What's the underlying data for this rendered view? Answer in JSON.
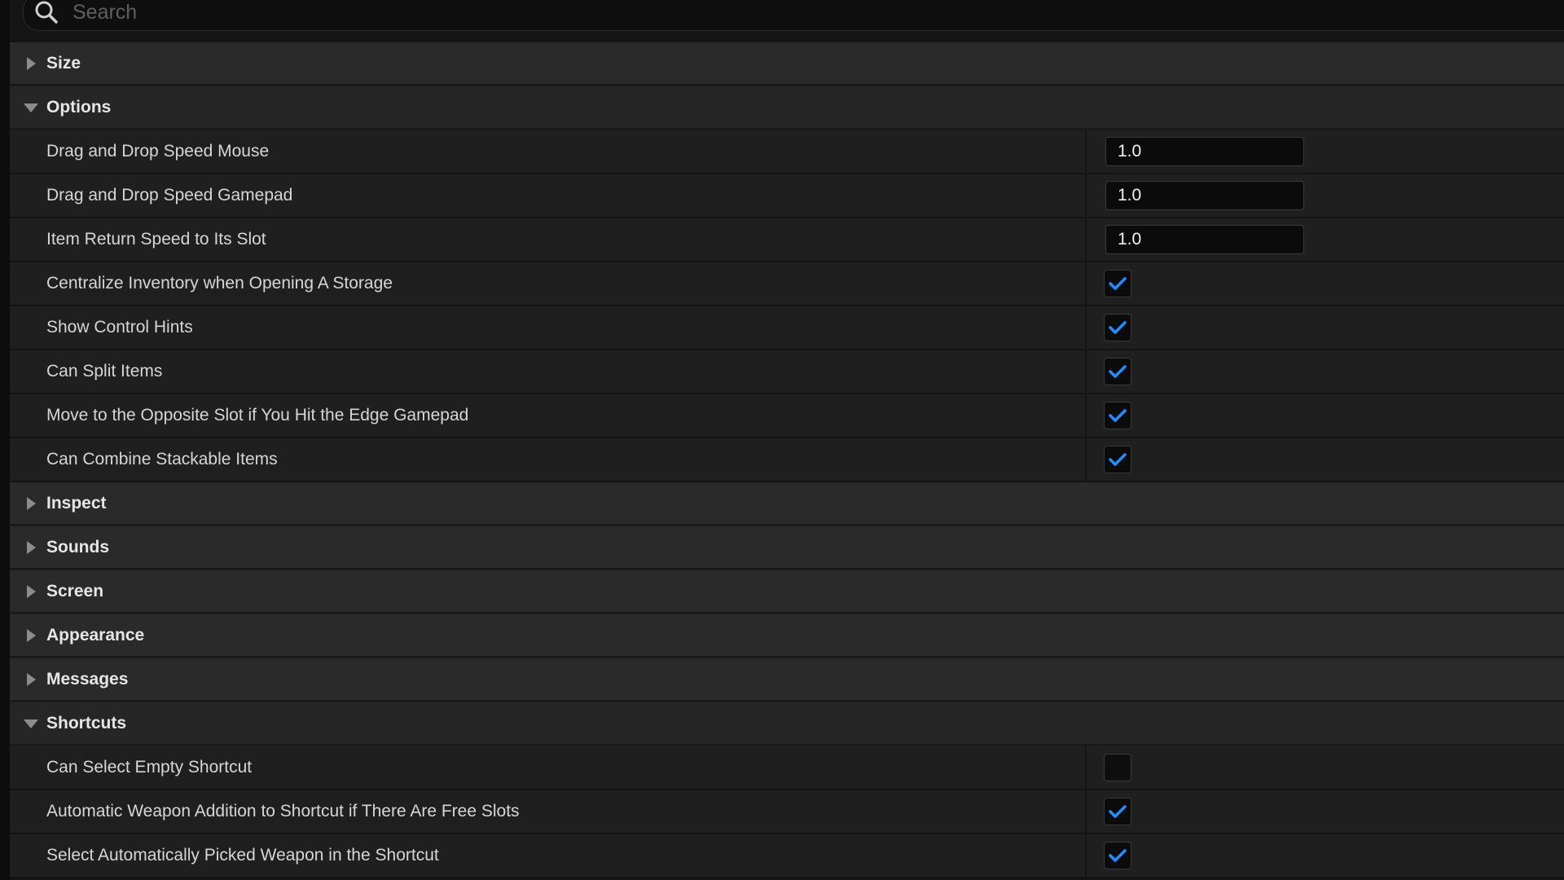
{
  "search": {
    "placeholder": "Search"
  },
  "colors": {
    "accent": "#1f8fff",
    "background": "#151515",
    "category_bg": "#2a2a2a",
    "property_bg": "#1f1f1f"
  },
  "categories": {
    "size": {
      "label": "Size",
      "expanded": false
    },
    "options": {
      "label": "Options",
      "expanded": true,
      "props": [
        {
          "label": "Drag and Drop Speed Mouse",
          "type": "number",
          "value": "1.0"
        },
        {
          "label": "Drag and Drop Speed Gamepad",
          "type": "number",
          "value": "1.0"
        },
        {
          "label": "Item Return Speed to Its Slot",
          "type": "number",
          "value": "1.0"
        },
        {
          "label": "Centralize Inventory when Opening A Storage",
          "type": "checkbox",
          "checked": true
        },
        {
          "label": "Show Control Hints",
          "type": "checkbox",
          "checked": true
        },
        {
          "label": "Can Split Items",
          "type": "checkbox",
          "checked": true
        },
        {
          "label": "Move to the Opposite Slot if You Hit the Edge Gamepad",
          "type": "checkbox",
          "checked": true
        },
        {
          "label": "Can Combine Stackable Items",
          "type": "checkbox",
          "checked": true
        }
      ]
    },
    "inspect": {
      "label": "Inspect",
      "expanded": false
    },
    "sounds": {
      "label": "Sounds",
      "expanded": false
    },
    "screen": {
      "label": "Screen",
      "expanded": false
    },
    "appearance": {
      "label": "Appearance",
      "expanded": false
    },
    "messages": {
      "label": "Messages",
      "expanded": false
    },
    "shortcuts": {
      "label": "Shortcuts",
      "expanded": true,
      "props": [
        {
          "label": "Can Select Empty Shortcut",
          "type": "checkbox",
          "checked": false
        },
        {
          "label": "Automatic Weapon Addition to Shortcut if There Are Free Slots",
          "type": "checkbox",
          "checked": true
        },
        {
          "label": "Select Automatically Picked Weapon in the Shortcut",
          "type": "checkbox",
          "checked": true
        }
      ]
    }
  }
}
